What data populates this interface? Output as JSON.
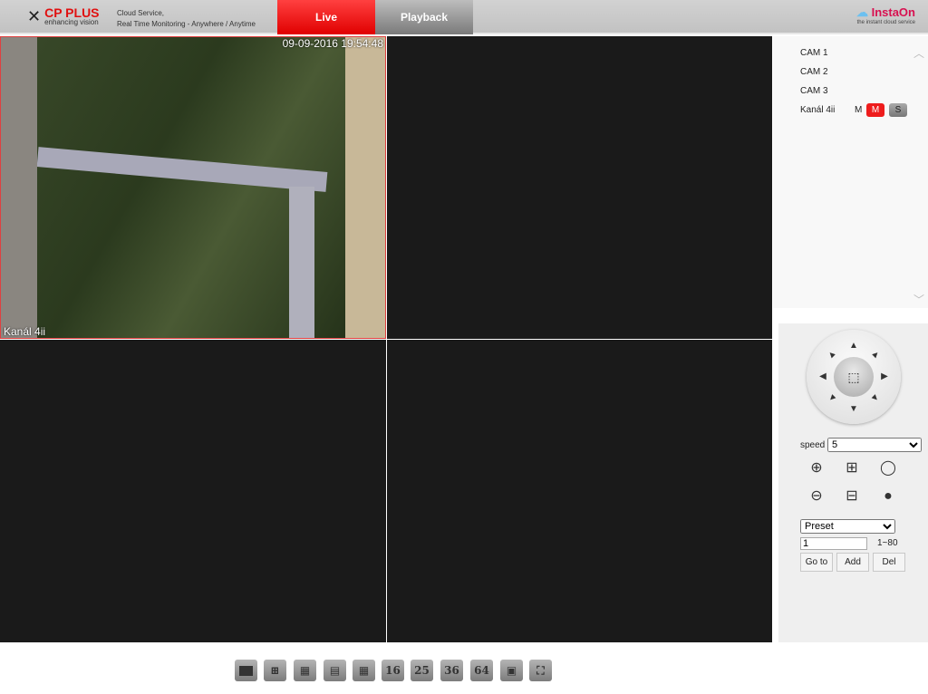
{
  "header": {
    "brand": "CP PLUS",
    "brand_tagline": "enhancing vision",
    "slogan_line1": "Cloud Service,",
    "slogan_line2": "Real Time Monitoring - Anywhere / Anytime",
    "tabs": [
      {
        "label": "Live",
        "active": true
      },
      {
        "label": "Playback",
        "active": false
      }
    ],
    "partner_logo": "InstaOn",
    "partner_tagline": "the instant cloud service"
  },
  "video": {
    "tiles": [
      {
        "channel": "Kanál 4ii",
        "timestamp": "09-09-2016 19:54:48",
        "selected": true
      },
      {},
      {},
      {}
    ]
  },
  "cameras": [
    "CAM 1",
    "CAM 2",
    "CAM 3",
    "Kanál 4ii"
  ],
  "cam_stream": {
    "label": "M",
    "main": "M",
    "sub": "S"
  },
  "ptz": {
    "speed_label": "speed",
    "speed": "5",
    "preset_select": "Preset",
    "preset_value": "1",
    "preset_range": "1~80",
    "goto": "Go to",
    "add": "Add",
    "del": "Del"
  },
  "layouts": [
    "1",
    "4",
    "6",
    "8",
    "9",
    "16",
    "25",
    "36",
    "64",
    "fit",
    "fullscreen"
  ],
  "layout_labels": {
    "16": "16",
    "25": "25",
    "36": "36",
    "64": "64"
  },
  "colors": {
    "accent": "#e00000"
  }
}
